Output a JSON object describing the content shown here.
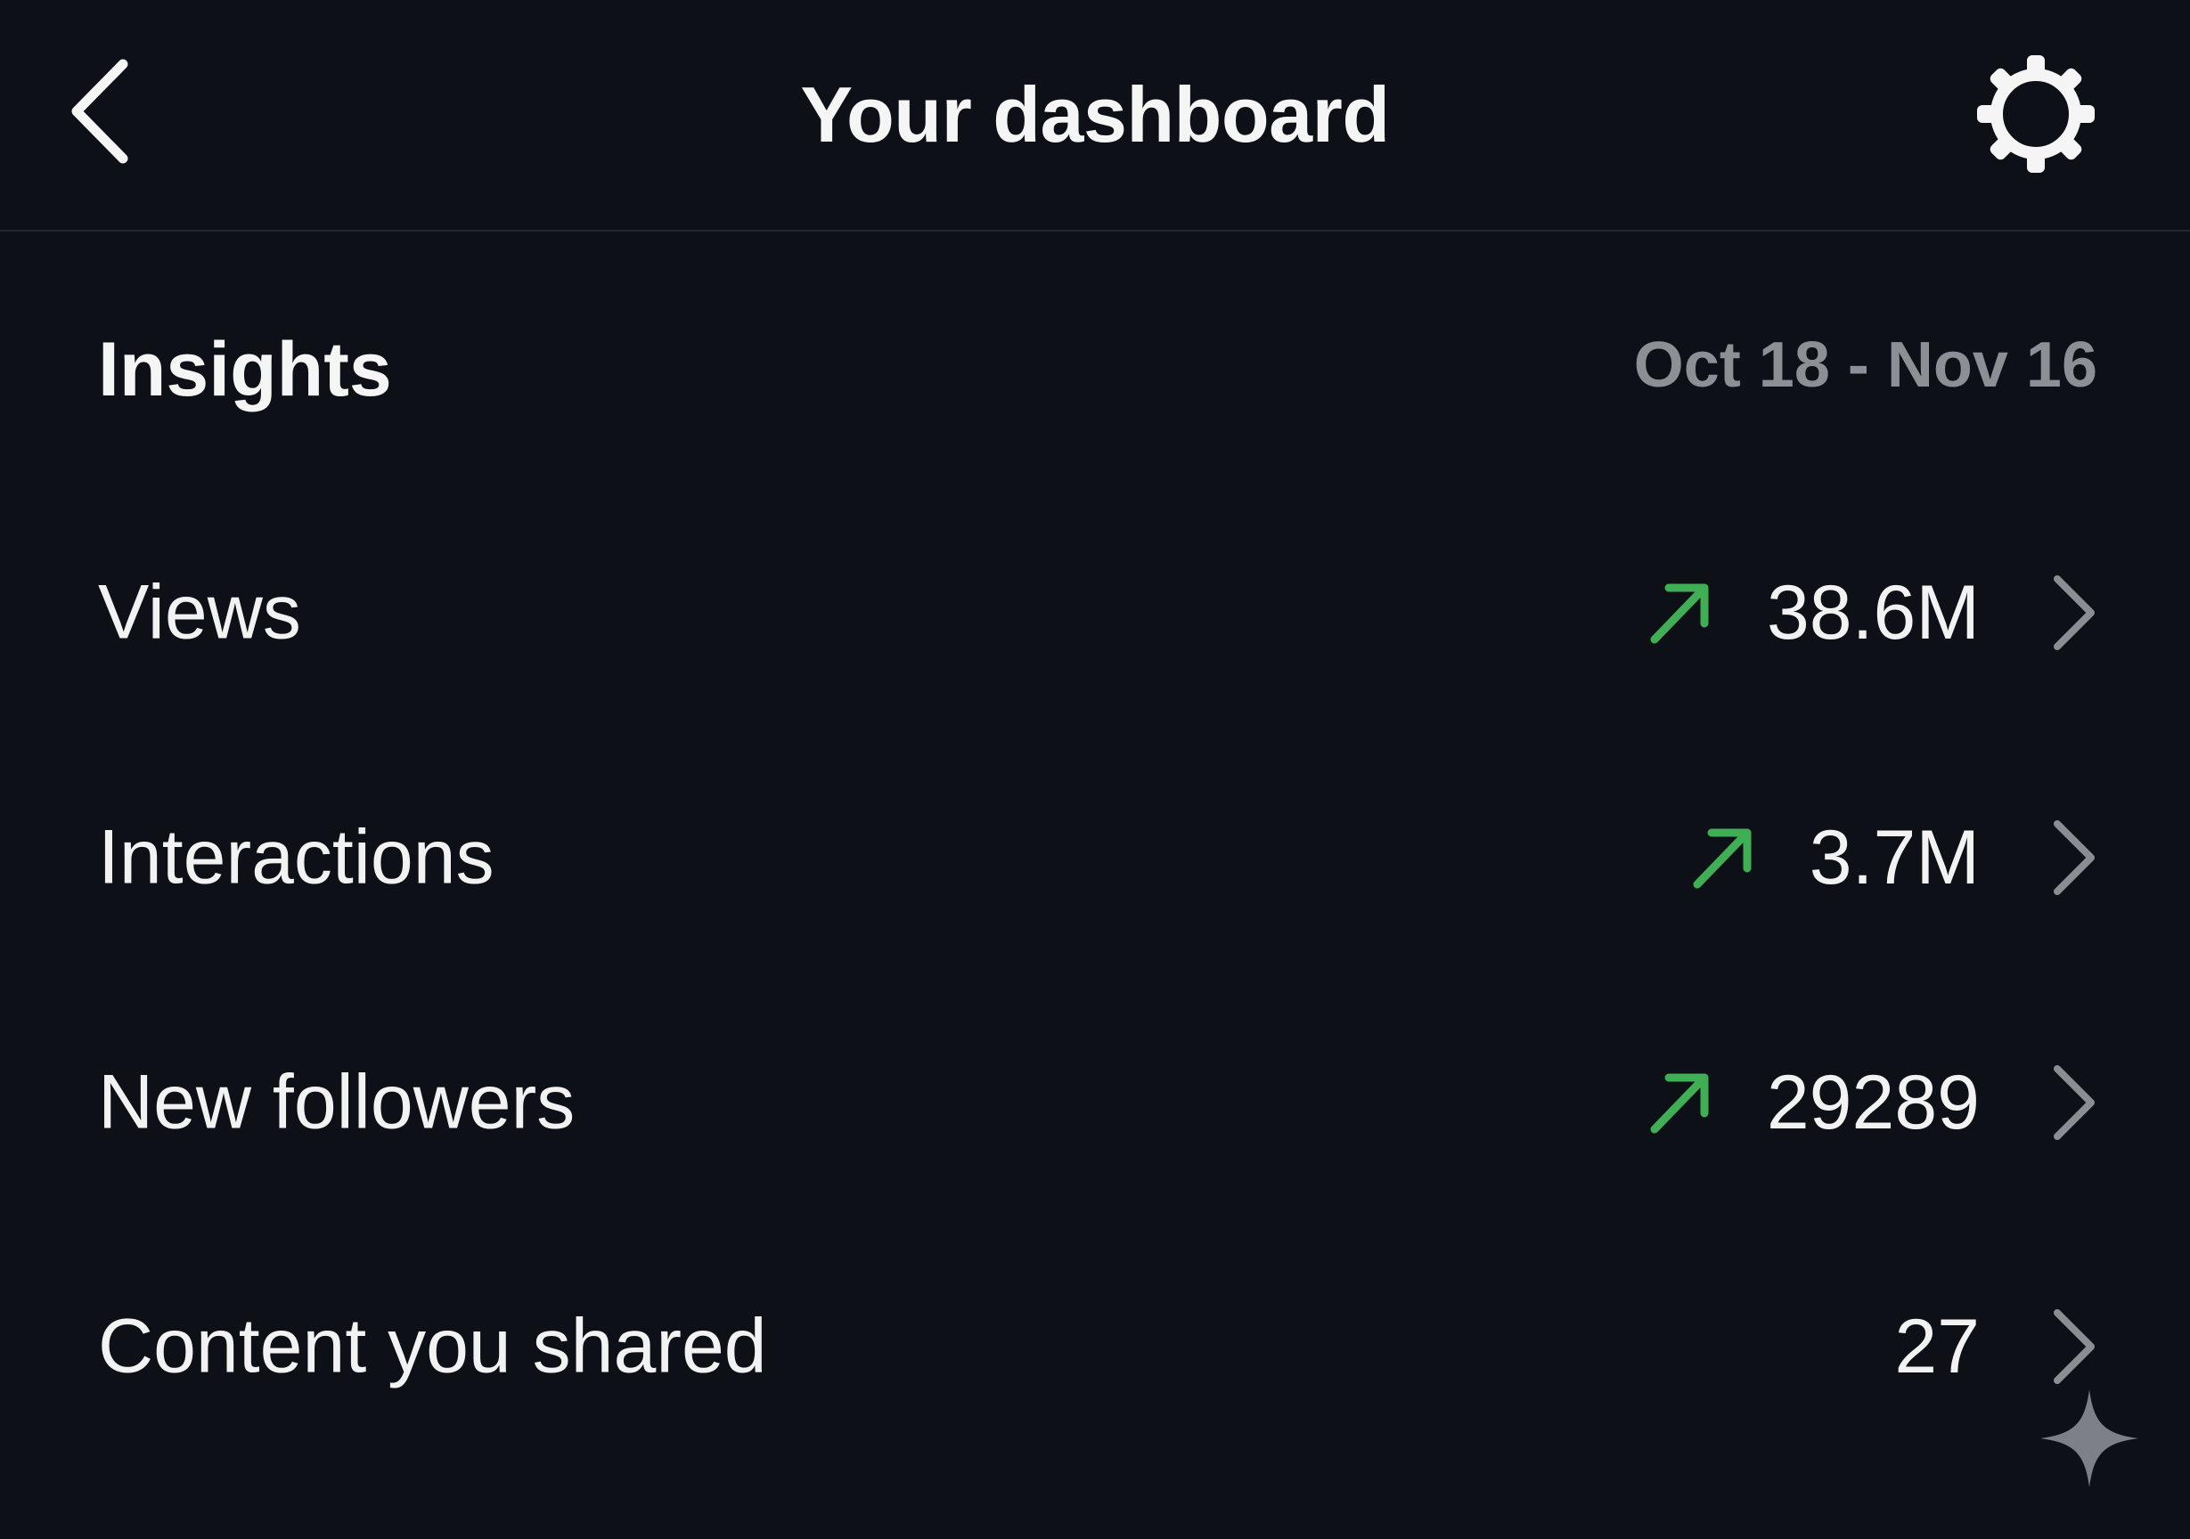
{
  "header": {
    "title": "Your dashboard",
    "back_icon": "chevron-left-icon",
    "settings_icon": "gear-icon"
  },
  "insights": {
    "title": "Insights",
    "date_range": "Oct 18 - Nov 16"
  },
  "metrics": [
    {
      "label": "Views",
      "value": "38.6M",
      "trend": "up"
    },
    {
      "label": "Interactions",
      "value": "3.7M",
      "trend": "up"
    },
    {
      "label": "New followers",
      "value": "29289",
      "trend": "up"
    },
    {
      "label": "Content you shared",
      "value": "27",
      "trend": "none"
    }
  ],
  "colors": {
    "background": "#0d1016",
    "text": "#f2f2f2",
    "muted": "#8c8f94",
    "trend_up": "#3fae55",
    "chevron": "#8a8d92"
  },
  "decorations": {
    "corner_icon": "sparkle-icon"
  }
}
